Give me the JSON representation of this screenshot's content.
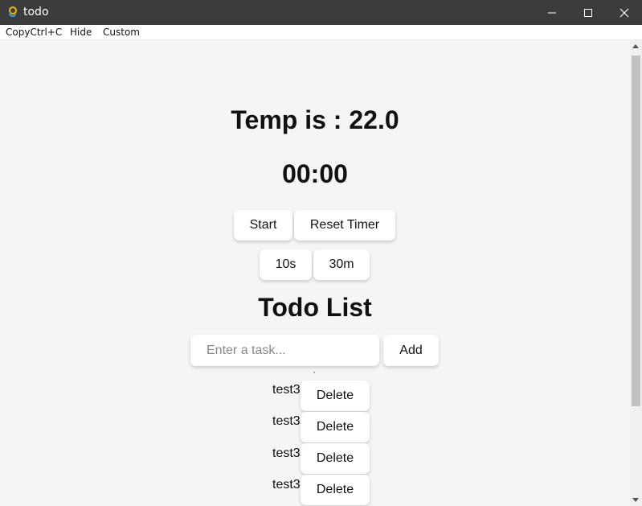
{
  "window": {
    "title": "todo"
  },
  "menu": {
    "items": [
      "CopyCtrl+C",
      "Hide",
      "Custom"
    ]
  },
  "temperature": {
    "text": "Temp is : 22.0"
  },
  "timer": {
    "display": "00:00",
    "start_label": "Start",
    "reset_label": "Reset Timer",
    "presets": [
      "10s",
      "30m"
    ]
  },
  "todo": {
    "title": "Todo List",
    "input_placeholder": "Enter a task...",
    "input_value": "",
    "add_label": "Add",
    "delete_label": "Delete",
    "tasks": [
      "test3",
      "test3",
      "test3",
      "test3"
    ]
  },
  "colors": {
    "titlebar": "#3c3c3c",
    "background": "#f5f5f5",
    "button": "#ffffff"
  },
  "icons": {
    "app": "app-logo-icon",
    "minimize": "minimize-icon",
    "maximize": "maximize-icon",
    "close": "close-icon"
  }
}
